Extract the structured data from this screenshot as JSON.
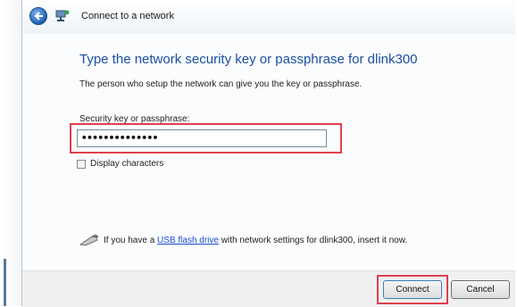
{
  "window": {
    "title": "Connect to a network"
  },
  "main": {
    "heading": "Type the network security key or passphrase for dlink300",
    "subtext": "The person who setup the network can give you the key or passphrase.",
    "field_label": "Security key or passphrase:",
    "password_value": "••••••••••••••",
    "display_characters_label": "Display characters",
    "display_characters_checked": false,
    "usb_text_before": "If you have a ",
    "usb_link": "USB flash drive",
    "usb_text_after": " with network settings for dlink300, insert it now."
  },
  "footer": {
    "connect_label": "Connect",
    "cancel_label": "Cancel"
  },
  "colors": {
    "heading": "#1c4fa0",
    "highlight": "#e04050",
    "link": "#1a4fcf"
  }
}
